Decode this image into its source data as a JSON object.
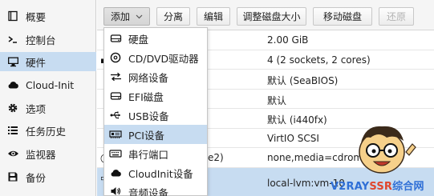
{
  "sidebar": {
    "items": [
      {
        "label": "概要",
        "icon": "book-icon"
      },
      {
        "label": "控制台",
        "icon": "terminal-icon"
      },
      {
        "label": "硬件",
        "icon": "desktop-icon",
        "active": true
      },
      {
        "label": "Cloud-Init",
        "icon": "cloud-icon"
      },
      {
        "label": "选项",
        "icon": "gear-icon"
      },
      {
        "label": "任务历史",
        "icon": "list-icon"
      },
      {
        "label": "监视器",
        "icon": "eye-icon"
      },
      {
        "label": "备份",
        "icon": "floppy-icon"
      }
    ]
  },
  "toolbar": {
    "add_label": "添加",
    "detach_label": "分离",
    "edit_label": "编辑",
    "resize_label": "调整磁盘大小",
    "move_label": "移动磁盘",
    "revert_label": "还原"
  },
  "add_menu": {
    "items": [
      {
        "label": "硬盘",
        "icon": "hdd-icon"
      },
      {
        "label": "CD/DVD驱动器",
        "icon": "cdrom-icon"
      },
      {
        "label": "网络设备",
        "icon": "network-arrows-icon"
      },
      {
        "label": "EFI磁盘",
        "icon": "hdd-icon"
      },
      {
        "label": "USB设备",
        "icon": "usb-icon"
      },
      {
        "label": "PCI设备",
        "icon": "pci-card-icon",
        "hover": true
      },
      {
        "label": "串行端口",
        "icon": "keyboard-icon"
      },
      {
        "label": "CloudInit设备",
        "icon": "cloud-icon"
      },
      {
        "label": "音频设备",
        "icon": "speaker-icon"
      }
    ]
  },
  "hardware_rows": [
    {
      "value": "2.00 GiB",
      "partial": ""
    },
    {
      "value": "4 (2 sockets, 2 cores)",
      "partial": ""
    },
    {
      "value": "默认 (SeaBIOS)",
      "partial": ""
    },
    {
      "value": "默认",
      "partial": ""
    },
    {
      "value": "默认 (i440fx)",
      "partial": ""
    },
    {
      "value": "VirtIO SCSI",
      "partial": ""
    },
    {
      "value": "none,media=cdrom",
      "partial": "e2)"
    },
    {
      "value": "local-lvm:vm-10",
      "partial": "",
      "selected": true
    }
  ],
  "watermark": {
    "part1": "V2RAY",
    "part2": "SSR",
    "part3": "综合网"
  },
  "colors": {
    "selection": "#c7dcf1",
    "toolbar_bg": "#f5f5f5",
    "watermark_blue": "#2f6fd6",
    "watermark_red": "#e0462d"
  }
}
